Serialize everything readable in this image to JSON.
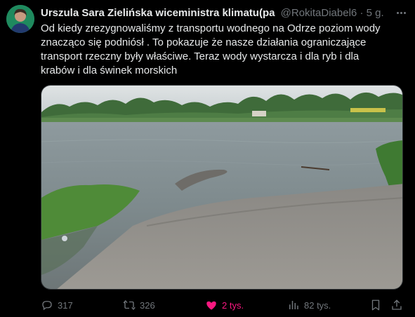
{
  "author": {
    "display_name": "Urszula Sara Zielińska wiceministra klimatu(pa",
    "handle": "@RokitaDiabel6",
    "separator": "·",
    "time": "5 g."
  },
  "tweet": {
    "lines": [
      "Od kiedy zrezygnowaliśmy z transportu wodnego na Odrze poziom wody",
      "znacząco się podniósł . To pokazuje że nasze działania ograniczające",
      "transport rzeczny były właściwe. Teraz wody wystarcza i dla ryb i dla",
      "krabów i dla świnek morskich"
    ]
  },
  "actions": {
    "replies": "317",
    "reposts": "326",
    "likes": "2 tys.",
    "views": "82 tys."
  },
  "icons": {
    "reply": "reply-icon",
    "repost": "repost-icon",
    "like": "heart-icon",
    "views": "views-icon",
    "bookmark": "bookmark-icon",
    "share": "share-icon",
    "more": "more-icon"
  },
  "colors": {
    "background": "#000000",
    "text": "#e7e9ea",
    "secondary": "#71767b",
    "like": "#f91880"
  }
}
